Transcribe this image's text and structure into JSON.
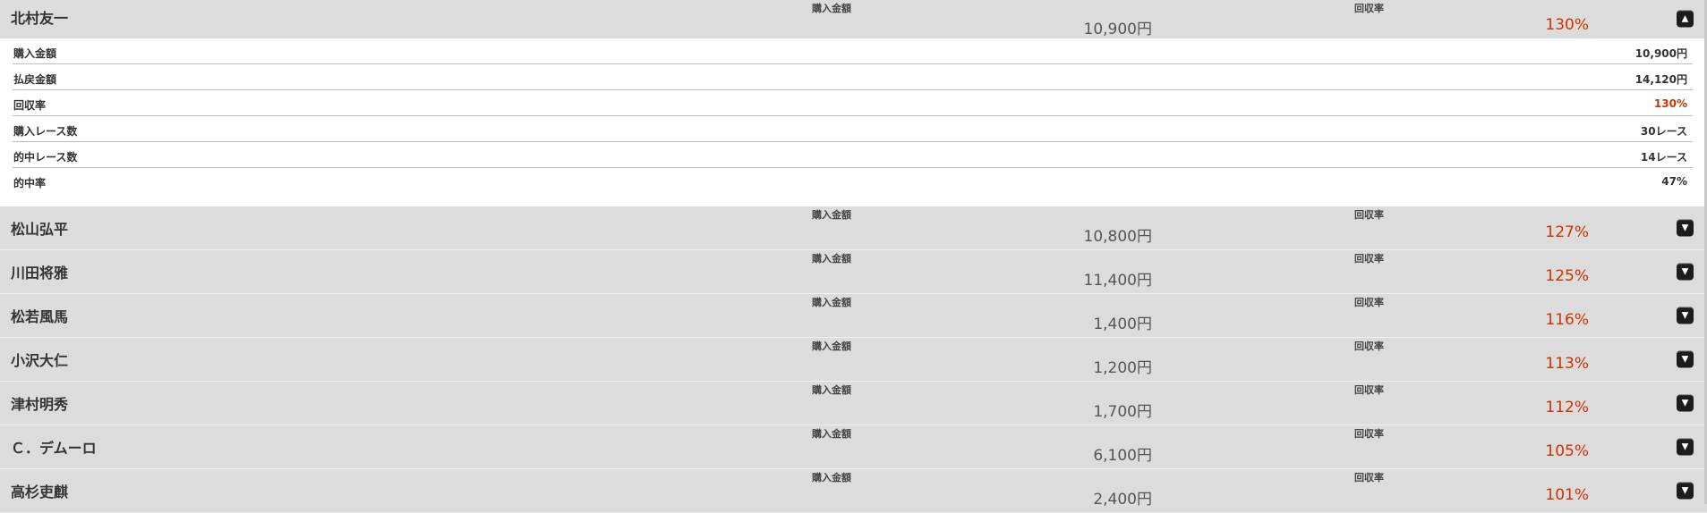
{
  "expanded": {
    "name": "北村友一",
    "purchase_label": "購入金額",
    "purchase_value": "10,900円",
    "recovery_label": "回収率",
    "recovery_value": "130%",
    "details": [
      {
        "label": "購入金額",
        "value": "10,900円",
        "highlight": false
      },
      {
        "label": "払戻金額",
        "value": "14,120円",
        "highlight": false
      },
      {
        "label": "回収率",
        "value": "130%",
        "highlight": true
      },
      {
        "label": "購入レース数",
        "value": "30レース",
        "highlight": false
      },
      {
        "label": "的中レース数",
        "value": "14レース",
        "highlight": false
      },
      {
        "label": "的中率",
        "value": "47%",
        "highlight": false
      }
    ]
  },
  "jockeys": [
    {
      "name": "松山弘平",
      "purchase_label": "購入金額",
      "purchase_value": "10,800円",
      "recovery_label": "回収率",
      "recovery_value": "127%"
    },
    {
      "name": "川田将雅",
      "purchase_label": "購入金額",
      "purchase_value": "11,400円",
      "recovery_label": "回収率",
      "recovery_value": "125%"
    },
    {
      "name": "松若風馬",
      "purchase_label": "購入金額",
      "purchase_value": "1,400円",
      "recovery_label": "回収率",
      "recovery_value": "116%"
    },
    {
      "name": "小沢大仁",
      "purchase_label": "購入金額",
      "purchase_value": "1,200円",
      "recovery_label": "回収率",
      "recovery_value": "113%"
    },
    {
      "name": "津村明秀",
      "purchase_label": "購入金額",
      "purchase_value": "1,700円",
      "recovery_label": "回収率",
      "recovery_value": "112%"
    },
    {
      "name": "Ｃ．デムーロ",
      "purchase_label": "購入金額",
      "purchase_value": "6,100円",
      "recovery_label": "回収率",
      "recovery_value": "105%"
    },
    {
      "name": "高杉吏麒",
      "purchase_label": "購入金額",
      "purchase_value": "2,400円",
      "recovery_label": "回収率",
      "recovery_value": "101%"
    }
  ],
  "icons": {
    "collapse": "triangle-up-icon",
    "expand": "triangle-down-icon"
  },
  "colors": {
    "header_bg": "#dcdcdc",
    "recovery_red": "#cc3300",
    "toggle_bg": "#1c1c1c"
  }
}
